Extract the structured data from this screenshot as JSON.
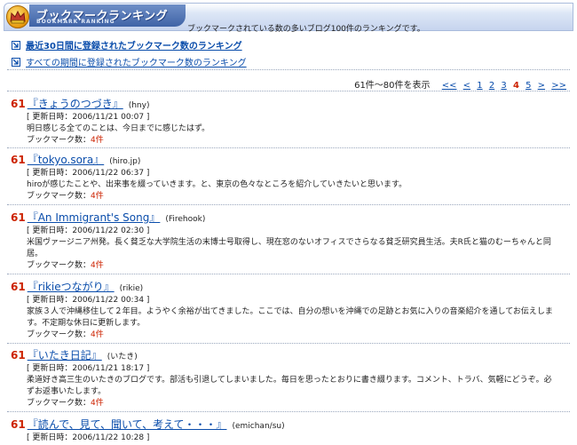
{
  "header": {
    "title": "ブックマークランキング",
    "subtitle": "BOOKMARK RANKING",
    "description": "ブックマークされている数の多いブログ100件のランキングです。"
  },
  "range_links": [
    {
      "label": "最近30日間に登録されたブックマーク数のランキング"
    },
    {
      "label": "すべての期間に登録されたブックマーク数のランキング"
    }
  ],
  "pager": {
    "range_text": "61件～80件を表示",
    "first": "<<",
    "prev": "<",
    "pages": [
      "1",
      "2",
      "3"
    ],
    "current": "4",
    "next_page": "5",
    "next": ">",
    "last": ">>"
  },
  "entries": [
    {
      "rank": "61",
      "title": "『きょうのつづき』",
      "author": "(hny)",
      "updated": "[ 更新日時：2006/11/21 00:07 ]",
      "desc": "明日感じる全てのことは、今日までに感じたはず。",
      "count_label": "ブックマーク数：",
      "count": "4件"
    },
    {
      "rank": "61",
      "title": "『tokyo.sora』",
      "author": "(hiro.jp)",
      "updated": "[ 更新日時：2006/11/22 06:37 ]",
      "desc": "hiroが感じたことや、出来事を綴っていきます。と、東京の色々なところを紹介していきたいと思います。",
      "count_label": "ブックマーク数：",
      "count": "4件"
    },
    {
      "rank": "61",
      "title": "『An Immigrant's Song』",
      "author": "(Firehook)",
      "updated": "[ 更新日時：2006/11/22 02:30 ]",
      "desc": "米国ヴァージニア州発。長く貧乏な大学院生活の末博士号取得し、現在窓のないオフィスでさらなる貧乏研究員生活。夫R氏と猫のむーちゃんと同居。",
      "count_label": "ブックマーク数：",
      "count": "4件"
    },
    {
      "rank": "61",
      "title": "『rikieつながり』",
      "author": "(rikie)",
      "updated": "[ 更新日時：2006/11/22 00:34 ]",
      "desc": "家族３人で沖縄移住して２年目。ようやく余裕が出てきました。ここでは、自分の想いを沖縄での足跡とお気に入りの音楽紹介を通してお伝えします。不定期な休日に更新します。",
      "count_label": "ブックマーク数：",
      "count": "4件"
    },
    {
      "rank": "61",
      "title": "『いたき日記』",
      "author": "(いたき)",
      "updated": "[ 更新日時：2006/11/21 18:17 ]",
      "desc": "柔道好き高三生のいたきのブログです。部活も引退してしまいました。毎日を思ったとおりに書き綴ります。コメント、トラバ、気軽にどうぞ。必ずお返事いたします。",
      "count_label": "ブックマーク数：",
      "count": "4件"
    },
    {
      "rank": "61",
      "title": "『読んで、見て、聞いて、考えて・・・』",
      "author": "(emichan/su)",
      "updated": "[ 更新日時：2006/11/22 10:28 ]",
      "desc": "",
      "count_label": "",
      "count": ""
    }
  ]
}
